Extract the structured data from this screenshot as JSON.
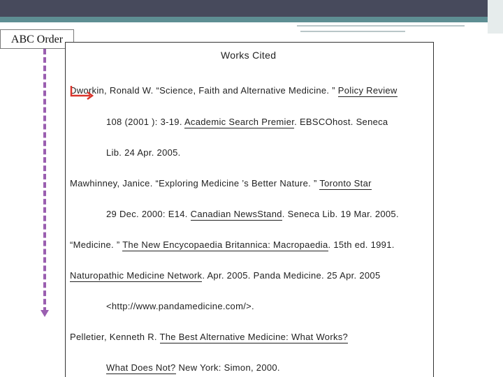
{
  "slide": {
    "title": "ABC Order"
  },
  "document": {
    "heading": "Works Cited",
    "lines": [
      {
        "parts": [
          {
            "t": "Dworkin, Ronald W.  “Science, Faith and Alternative Medicine. ” "
          },
          {
            "t": "Policy Review",
            "u": true
          }
        ]
      },
      {
        "parts": [
          {
            "t": "108  (2001 ): 3-19. "
          },
          {
            "t": "Academic Search Premier",
            "u": true
          },
          {
            "t": ". EBSCOhost. Seneca"
          }
        ]
      },
      {
        "parts": [
          {
            "t": "Lib. 24 Apr. 2005."
          }
        ]
      },
      {
        "parts": [
          {
            "t": "Mawhinney, Janice.  “Exploring Medicine ’s  Better Nature. ” "
          },
          {
            "t": "Toronto Star",
            "u": true
          }
        ]
      },
      {
        "parts": [
          {
            "t": "29 Dec. 2000: E14. "
          },
          {
            "t": "Canadian NewsStand",
            "u": true
          },
          {
            "t": ". Seneca Lib. 19 Mar. 2005."
          }
        ]
      },
      {
        "parts": [
          {
            "t": "“Medicine. ” "
          },
          {
            "t": "The New Encycopaedia Britannica: Macropaedia",
            "u": true
          },
          {
            "t": ". 15th ed. 1991."
          }
        ]
      },
      {
        "parts": [
          {
            "t": "Naturopathic Medicine Network",
            "u": true
          },
          {
            "t": ". Apr. 2005. Panda Medicine. 25 Apr. 2005"
          }
        ]
      },
      {
        "parts": [
          {
            "t": "<http://www.pandamedicine.com/>."
          }
        ]
      },
      {
        "parts": [
          {
            "t": "Pelletier, Kenneth R. "
          },
          {
            "t": "The Best Alternative Medicine: What Works?",
            "u": true
          }
        ]
      },
      {
        "parts": [
          {
            "t": "What Does Not?",
            "u": true
          },
          {
            "t": "  New York: Simon, 2000."
          }
        ]
      }
    ]
  },
  "colors": {
    "header_dark": "#474a5c",
    "header_teal": "#5e8e93",
    "dashed_arrow": "#9a5fb0",
    "indent_arrow": "#d9342b"
  },
  "icons": {
    "indent_arrow": "red-bent-arrow-icon",
    "order_arrow": "dashed-down-arrow-icon"
  }
}
